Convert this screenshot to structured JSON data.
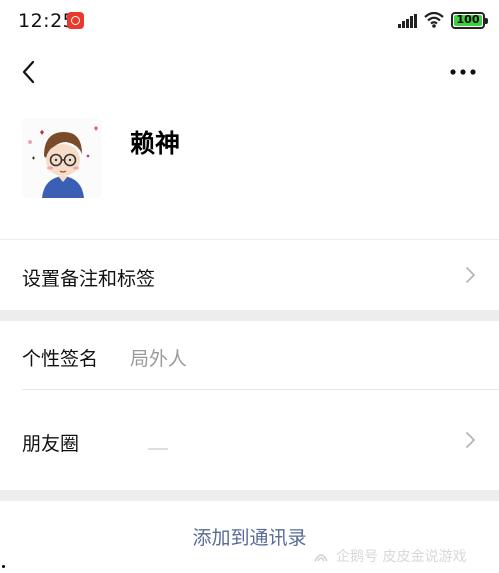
{
  "status_bar": {
    "time": "12:25",
    "battery_level": "100",
    "app_badge_icon": "netease-music-icon",
    "signal_icon": "signal-icon",
    "wifi_icon": "wifi-icon"
  },
  "nav": {
    "back_icon": "chevron-left-icon",
    "more_icon": "more-dots-icon"
  },
  "profile": {
    "name": "赖神",
    "avatar_icon": "cartoon-avatar-icon"
  },
  "rows": {
    "remark": {
      "label": "设置备注和标签"
    },
    "signature": {
      "label": "个性签名",
      "value": "局外人"
    },
    "moments": {
      "label": "朋友圈"
    }
  },
  "actions": {
    "add_to_contacts": "添加到通讯录"
  },
  "watermark": {
    "text": "企鹅号 皮皮金说游戏"
  },
  "colors": {
    "link_blue": "#576b95",
    "separator": "#ededed",
    "battery_green": "#3ecf3e",
    "badge_red": "#e8392b"
  }
}
